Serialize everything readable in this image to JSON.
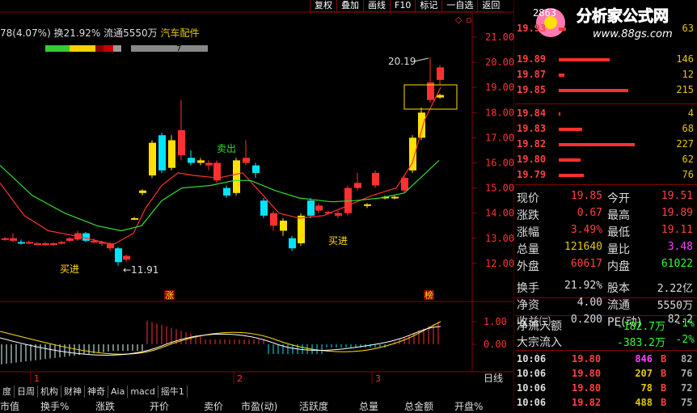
{
  "toolbar": {
    "items": [
      "复权",
      "叠加",
      "画线",
      "F10",
      "标记",
      "一自选",
      "返回"
    ]
  },
  "info": {
    "text": "78(4.07%) 换21.92% 流通5550万",
    "industry": "汽车配件",
    "small_num": "7"
  },
  "chart": {
    "price_axis": [
      "21.00",
      "20.00",
      "19.00",
      "18.00",
      "17.00",
      "16.00",
      "15.00",
      "14.00",
      "13.00",
      "12.00"
    ],
    "high_label": "20.19",
    "low_label": "←11.91",
    "buy_label": "买进",
    "sell_label": "卖出",
    "mark_up": "涨",
    "mark_list": "榜",
    "macd_axis": [
      "1.00",
      "0.00"
    ],
    "x_ticks": [
      "1",
      "2",
      "3"
    ],
    "period": "日线",
    "colors": {
      "up": "#ff3030",
      "down": "#00e5ff",
      "yellow": "#ffe000",
      "ma_red": "#ff3030",
      "ma_green": "#33dd33"
    }
  },
  "bottom": {
    "tabs": [
      "度",
      "日周",
      "机构",
      "财神",
      "神奇",
      "Aia",
      "macd",
      "摇牛1"
    ],
    "columns": [
      "市值",
      "换手%",
      "涨跌",
      "开价",
      "卖价",
      "市盈(动)",
      "活跃度",
      "总量",
      "总金额",
      "开盘%"
    ]
  },
  "logo": {
    "text": "分析家公式网",
    "url": "www.88gs.com",
    "code": "2863"
  },
  "orderbook": [
    {
      "price": "19.93",
      "vol": "63",
      "bar": 0.05
    },
    {
      "price": "19.89",
      "vol": "146",
      "bar": 0.35
    },
    {
      "price": "19.87",
      "vol": "12",
      "bar": 0.04
    },
    {
      "price": "19.85",
      "vol": "215",
      "bar": 0.48
    },
    {
      "price": "19.84",
      "vol": "4",
      "bar": 0.01
    },
    {
      "price": "19.83",
      "vol": "68",
      "bar": 0.16
    },
    {
      "price": "19.82",
      "vol": "227",
      "bar": 0.52
    },
    {
      "price": "19.80",
      "vol": "62",
      "bar": 0.15
    },
    {
      "price": "19.79",
      "vol": "76",
      "bar": 0.17
    }
  ],
  "quote": [
    {
      "l1": "现价",
      "v1": "19.85",
      "c1": "#ff4040",
      "l2": "今开",
      "v2": "19.51",
      "c2": "#ff4040"
    },
    {
      "l1": "涨跌",
      "v1": "0.67",
      "c1": "#ff4040",
      "l2": "最高",
      "v2": "19.89",
      "c2": "#ff4040"
    },
    {
      "l1": "涨幅",
      "v1": "3.49%",
      "c1": "#ff4040",
      "l2": "最低",
      "v2": "19.11",
      "c2": "#ff4040"
    },
    {
      "l1": "总量",
      "v1": "121640",
      "c1": "#e6c800",
      "l2": "量比",
      "v2": "3.48",
      "c2": "#ff40ff"
    },
    {
      "l1": "外盘",
      "v1": "60617",
      "c1": "#ff4040",
      "l2": "内盘",
      "v2": "61022",
      "c2": "#33ff33"
    },
    {
      "l1": "换手",
      "v1": "21.92%",
      "c1": "#dddddd",
      "l2": "股本",
      "v2": "2.22亿",
      "c2": "#dddddd"
    },
    {
      "l1": "净资",
      "v1": "4.00",
      "c1": "#dddddd",
      "l2": "流通",
      "v2": "5550万",
      "c2": "#dddddd"
    },
    {
      "l1": "收益㈢",
      "v1": "0.200",
      "c1": "#dddddd",
      "l2": "PE(动)",
      "v2": "82.2",
      "c2": "#dddddd"
    }
  ],
  "flow": [
    {
      "label": "净流入额",
      "val": "-182.7万",
      "pct": "-1%"
    },
    {
      "label": "大宗流入",
      "val": "-383.2万",
      "pct": "-2%"
    }
  ],
  "ticks": [
    {
      "time": "10:06",
      "price": "19.80",
      "vol": "846",
      "side": "B",
      "n": "82",
      "vc": "#ff40ff"
    },
    {
      "time": "10:06",
      "price": "19.80",
      "vol": "207",
      "side": "B",
      "n": "76",
      "vc": "#e6c800"
    },
    {
      "time": "10:06",
      "price": "19.80",
      "vol": "78",
      "side": "B",
      "n": "72",
      "vc": "#e6c800"
    },
    {
      "time": "10:06",
      "price": "19.82",
      "vol": "488",
      "side": "B",
      "n": "75",
      "vc": "#e6c800"
    }
  ]
}
